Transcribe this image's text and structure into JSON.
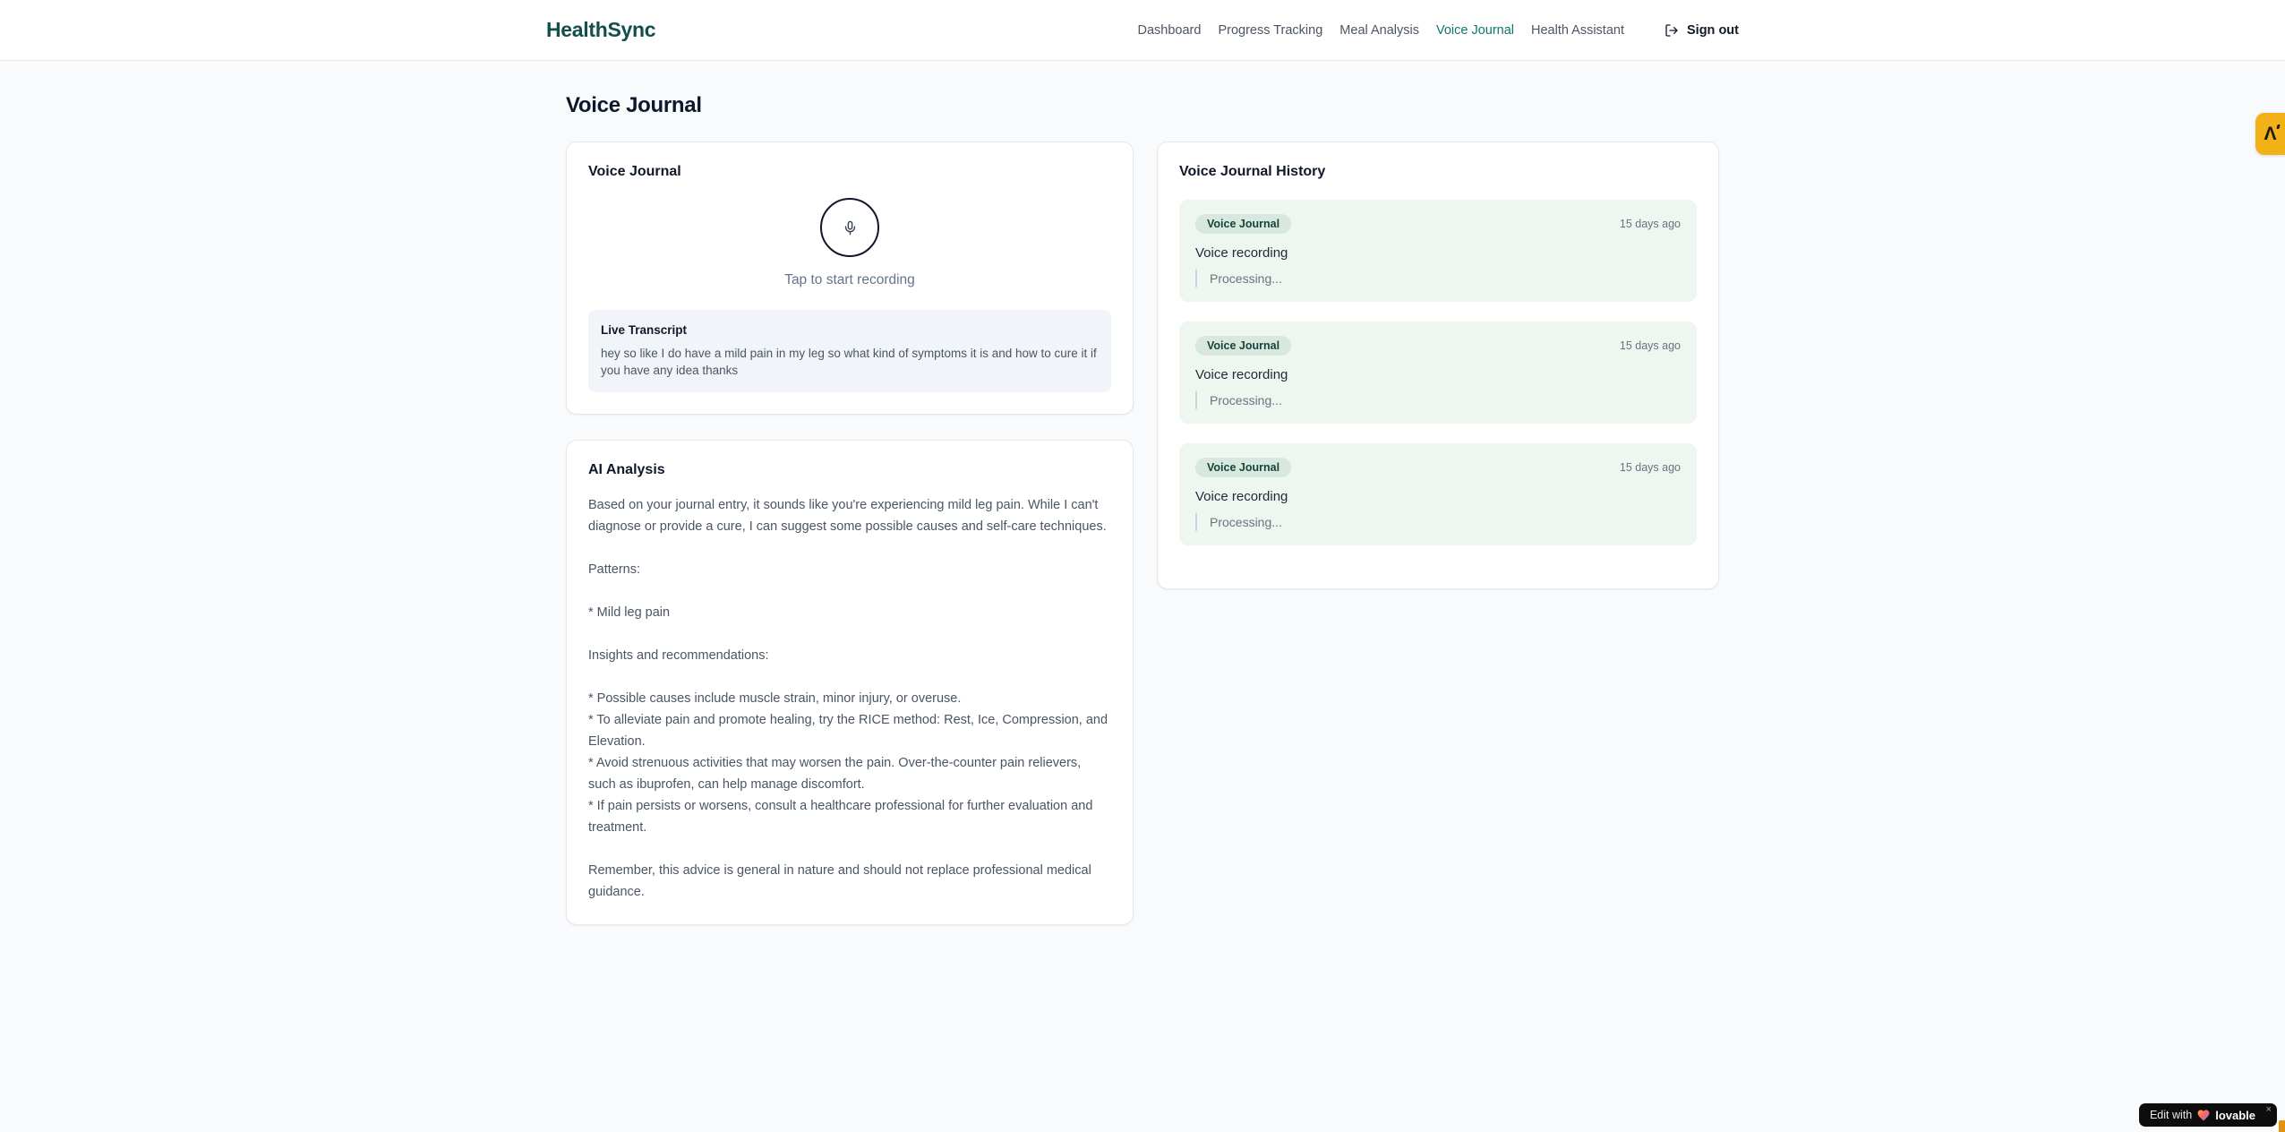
{
  "brand": {
    "name": "HealthSync"
  },
  "nav": {
    "items": [
      {
        "label": "Dashboard",
        "active": false
      },
      {
        "label": "Progress Tracking",
        "active": false
      },
      {
        "label": "Meal Analysis",
        "active": false
      },
      {
        "label": "Voice Journal",
        "active": true
      },
      {
        "label": "Health Assistant",
        "active": false
      }
    ],
    "sign_out_label": "Sign out"
  },
  "page": {
    "title": "Voice Journal"
  },
  "recorder_card": {
    "title": "Voice Journal",
    "mic_icon": "microphone-icon",
    "tap_hint": "Tap to start recording",
    "transcript_title": "Live Transcript",
    "transcript_text": "hey so like I do have a mild pain in my leg so what kind of symptoms it is and how to cure it if you have any idea thanks"
  },
  "analysis_card": {
    "title": "AI Analysis",
    "body": "Based on your journal entry, it sounds like you're experiencing mild leg pain. While I can't diagnose or provide a cure, I can suggest some possible causes and self-care techniques.\n\nPatterns:\n\n* Mild leg pain\n\nInsights and recommendations:\n\n* Possible causes include muscle strain, minor injury, or overuse.\n* To alleviate pain and promote healing, try the RICE method: Rest, Ice, Compression, and Elevation.\n* Avoid strenuous activities that may worsen the pain. Over-the-counter pain relievers, such as ibuprofen, can help manage discomfort.\n* If pain persists or worsens, consult a healthcare professional for further evaluation and treatment.\n\nRemember, this advice is general in nature and should not replace professional medical guidance."
  },
  "history_card": {
    "title": "Voice Journal History",
    "entries": [
      {
        "badge": "Voice Journal",
        "time": "15 days ago",
        "label": "Voice recording",
        "status": "Processing..."
      },
      {
        "badge": "Voice Journal",
        "time": "15 days ago",
        "label": "Voice recording",
        "status": "Processing..."
      },
      {
        "badge": "Voice Journal",
        "time": "15 days ago",
        "label": "Voice recording",
        "status": "Processing..."
      }
    ]
  },
  "floating": {
    "extension": {
      "glyph": "Λ",
      "icon": "lambda-logo-icon"
    },
    "lovable": {
      "prefix": "Edit with",
      "brand": "lovable",
      "close": "×",
      "icon": "heart-icon"
    }
  },
  "colors": {
    "brand_teal": "#134e4a",
    "active_nav": "#0f766e",
    "page_bg": "#f8fafc",
    "history_entry_bg": "#edf6ef",
    "badge_bg": "#d8e8de",
    "badge_text": "#15433c",
    "amber_badge": "#f2b116",
    "lovable_bg": "#0d0d0e"
  }
}
